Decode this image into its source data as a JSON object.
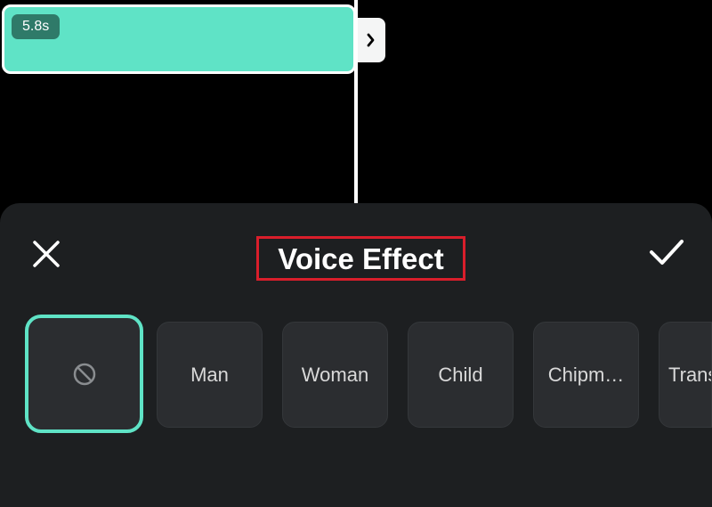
{
  "timeline": {
    "clip_duration": "5.8s",
    "clip_color": "#5fe3c6",
    "handle_icon": "chevron-right-icon"
  },
  "panel": {
    "title": "Voice Effect",
    "close_icon": "close-icon",
    "confirm_icon": "checkmark-icon",
    "effects": [
      {
        "label": "",
        "icon": "none-icon",
        "selected": true
      },
      {
        "label": "Man",
        "selected": false
      },
      {
        "label": "Woman",
        "selected": false
      },
      {
        "label": "Child",
        "selected": false
      },
      {
        "label": "Chipm…",
        "selected": false
      },
      {
        "label": "Trans",
        "selected": false
      }
    ]
  },
  "colors": {
    "accent": "#5fe3c6",
    "highlight_box": "#d91e2b",
    "panel_bg": "#1d1f21",
    "tile_bg": "#2b2d30"
  }
}
